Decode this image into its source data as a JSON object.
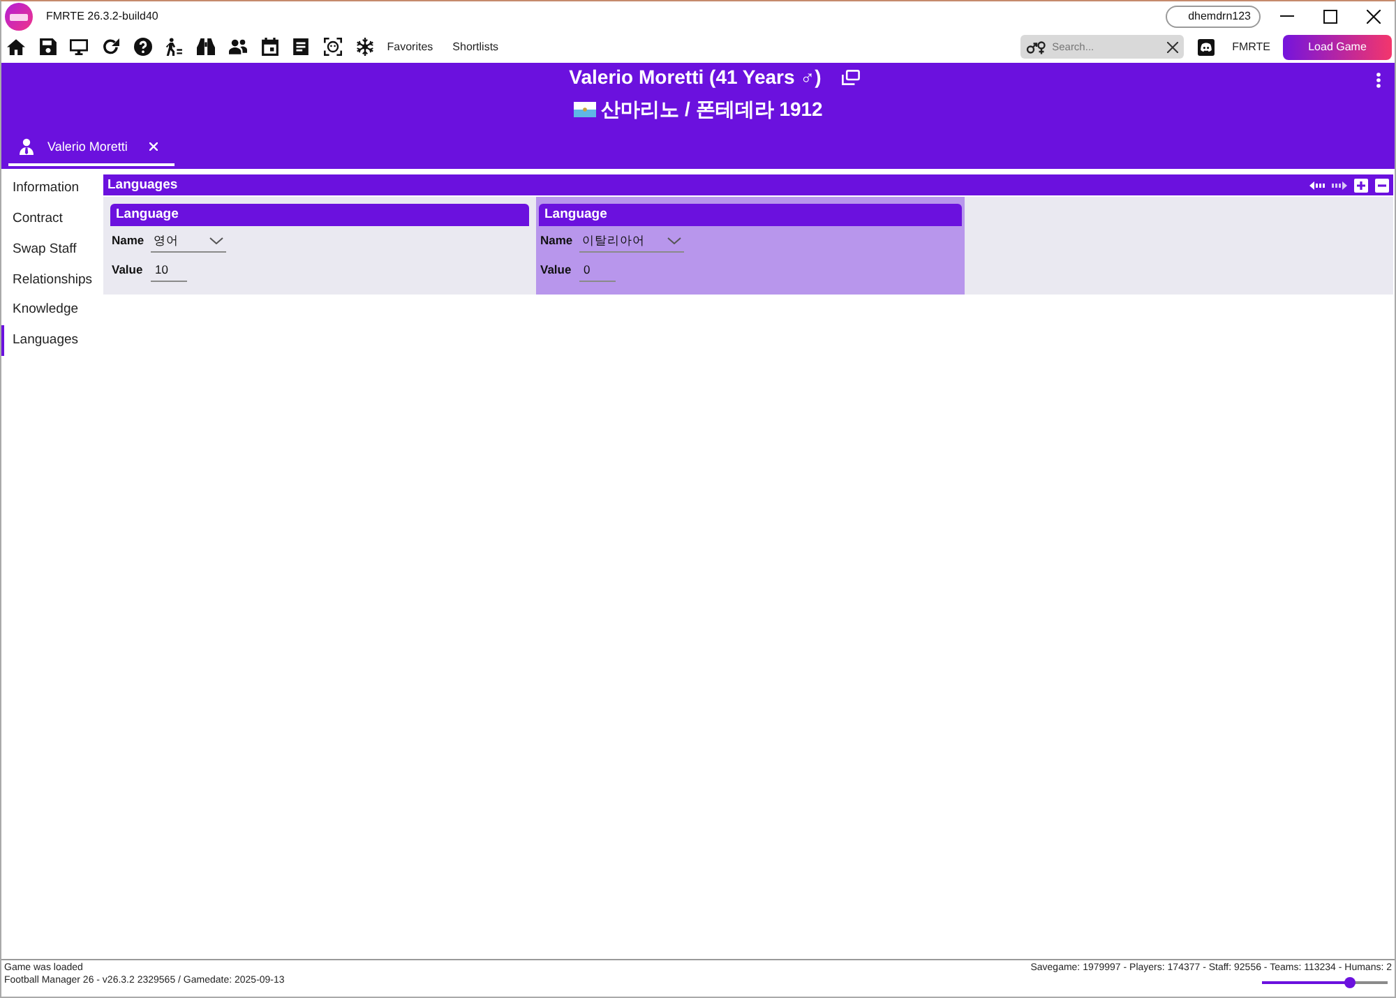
{
  "window": {
    "title": "FMRTE 26.3.2-build40",
    "user": "dhemdrn123"
  },
  "toolbar": {
    "links": [
      "Favorites",
      "Shortlists"
    ],
    "search": {
      "placeholder": "Search..."
    },
    "brand_link": "FMRTE",
    "load_button": "Load Game"
  },
  "header": {
    "title": "Valerio Moretti (41 Years ♂)",
    "subtitle": "산마리노 / 폰테데라 1912"
  },
  "tabs": [
    {
      "label": "Valerio Moretti",
      "selected": true
    }
  ],
  "sidebar": {
    "items": [
      {
        "label": "Information",
        "selected": false
      },
      {
        "label": "Contract",
        "selected": false
      },
      {
        "label": "Swap Staff",
        "selected": false
      },
      {
        "label": "Relationships",
        "selected": false
      },
      {
        "label": "Knowledge",
        "selected": false
      },
      {
        "label": "Languages",
        "selected": true
      }
    ]
  },
  "panel": {
    "title": "Languages",
    "cards": [
      {
        "title": "Language",
        "selected": false,
        "fields": [
          {
            "label": "Name",
            "kind": "dropdown",
            "value": "영어"
          },
          {
            "label": "Value",
            "kind": "number",
            "value": "10"
          }
        ]
      },
      {
        "title": "Language",
        "selected": true,
        "fields": [
          {
            "label": "Name",
            "kind": "dropdown",
            "value": "이탈리아어"
          },
          {
            "label": "Value",
            "kind": "number",
            "value": "0"
          }
        ]
      }
    ]
  },
  "status_bar": {
    "message": "Game was loaded",
    "version": "Football Manager 26 - v26.3.2 2329565 / Gamedate: 2025-09-13",
    "stats": "Savegame: 1979997 - Players: 174377 - Staff: 92556 - Teams: 113234 - Humans: 2",
    "zoom_slider": {
      "level": 0.7
    }
  }
}
